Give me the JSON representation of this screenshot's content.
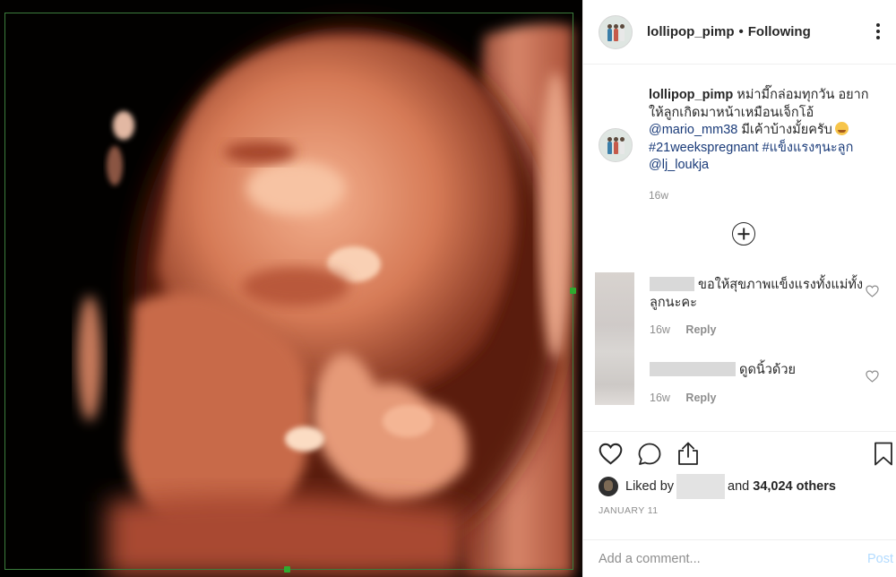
{
  "post": {
    "username": "lollipop_pimp",
    "separator": "•",
    "follow_status": "Following",
    "more_icon": "more-horizontal-icon",
    "caption": {
      "username": "lollipop_pimp",
      "text_before": "หม่ามี๊กล่อมทุกวัน อยากให้ลูกเกิดมาหน้าเหมือนเจ็กโอ้",
      "mention": "@mario_mm38",
      "text_after": "มีเค้าบ้างมั้ยครับ",
      "hashtag_1": "#21weekspregnant",
      "hashtag_2": "#แข็งแรงๆนะลูก",
      "mention_2": "@lj_loukja",
      "timestamp": "16w"
    },
    "load_more_icon": "plus-circle-icon",
    "comments": [
      {
        "text": "ขอให้สุขภาพแข็งแรงทั้งแม่ทั้งลูกนะคะ",
        "time": "16w",
        "reply": "Reply"
      },
      {
        "text": "ดูดนิ้วด้วย",
        "time": "16w",
        "reply": "Reply"
      }
    ],
    "likes": {
      "liked_by": "Liked by",
      "and": "and",
      "others": "34,024 others"
    },
    "date": "JANUARY 11",
    "add_comment": {
      "placeholder": "Add a comment...",
      "post_label": "Post"
    }
  },
  "colors": {
    "link": "#1a3b79",
    "muted": "#8e8e8e",
    "post_disabled": "#b3dbff",
    "frame_green": "#2faa2f"
  }
}
